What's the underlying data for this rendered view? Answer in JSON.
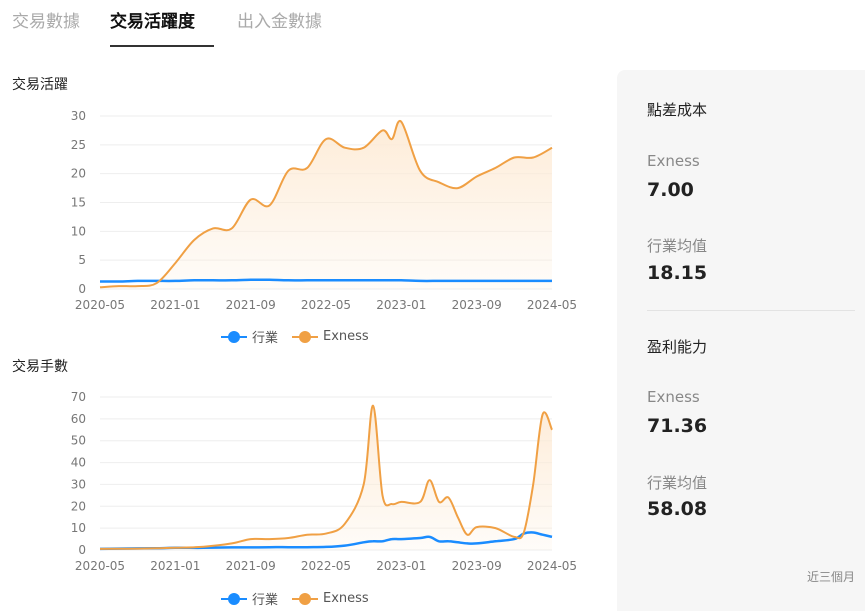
{
  "tabs": [
    {
      "label": "交易數據"
    },
    {
      "label": "交易活躍度"
    },
    {
      "label": "出入金數據"
    }
  ],
  "colors": {
    "industry": "#1a8cff",
    "exness": "#f0a044",
    "exness_fill": "#fdebd6"
  },
  "legend": {
    "industry": "行業",
    "exness": "Exness"
  },
  "charts": {
    "activity_title": "交易活躍",
    "volume_title": "交易手數"
  },
  "side": {
    "spread_title": "點差成本",
    "spread_exness_label": "Exness",
    "spread_exness_value": "7.00",
    "spread_industry_label": "行業均值",
    "spread_industry_value": "18.15",
    "profit_title": "盈利能力",
    "profit_exness_label": "Exness",
    "profit_exness_value": "71.36",
    "profit_industry_label": "行業均值",
    "profit_industry_value": "58.08",
    "footnote": "近三個月"
  },
  "chart_data": [
    {
      "type": "area",
      "title": "交易活躍",
      "x_ticks": [
        "2020-05",
        "2021-01",
        "2021-09",
        "2022-05",
        "2023-01",
        "2023-09",
        "2024-05"
      ],
      "ylim": [
        0,
        30
      ],
      "y_ticks": [
        0,
        5,
        10,
        15,
        20,
        25,
        30
      ],
      "x": [
        "2020-05",
        "2020-07",
        "2020-09",
        "2020-11",
        "2021-01",
        "2021-03",
        "2021-05",
        "2021-07",
        "2021-09",
        "2021-11",
        "2022-01",
        "2022-03",
        "2022-05",
        "2022-07",
        "2022-09",
        "2022-11",
        "2022-12",
        "2023-01",
        "2023-03",
        "2023-05",
        "2023-07",
        "2023-09",
        "2023-11",
        "2024-01",
        "2024-03",
        "2024-05"
      ],
      "series": [
        {
          "name": "行業",
          "values": [
            1.3,
            1.3,
            1.4,
            1.4,
            1.4,
            1.5,
            1.5,
            1.5,
            1.6,
            1.6,
            1.5,
            1.5,
            1.5,
            1.5,
            1.5,
            1.5,
            1.5,
            1.5,
            1.4,
            1.4,
            1.4,
            1.4,
            1.4,
            1.4,
            1.4,
            1.4
          ]
        },
        {
          "name": "Exness",
          "values": [
            0.3,
            0.5,
            0.5,
            1.0,
            4.5,
            8.5,
            10.5,
            10.5,
            15.5,
            14.5,
            20.5,
            21.0,
            26.0,
            24.5,
            24.5,
            27.5,
            26.0,
            29.0,
            20.5,
            18.5,
            17.5,
            19.5,
            21.0,
            22.8,
            22.8,
            24.5
          ]
        }
      ],
      "grid": true,
      "legend_position": "bottom"
    },
    {
      "type": "area",
      "title": "交易手數",
      "x_ticks": [
        "2020-05",
        "2021-01",
        "2021-09",
        "2022-05",
        "2023-01",
        "2023-09",
        "2024-05"
      ],
      "ylim": [
        0,
        70
      ],
      "y_ticks": [
        0,
        10,
        20,
        30,
        40,
        50,
        60,
        70
      ],
      "x": [
        "2020-05",
        "2020-08",
        "2020-11",
        "2021-01",
        "2021-04",
        "2021-07",
        "2021-09",
        "2021-11",
        "2022-01",
        "2022-03",
        "2022-05",
        "2022-07",
        "2022-09",
        "2022-10",
        "2022-11",
        "2022-12",
        "2023-01",
        "2023-03",
        "2023-04",
        "2023-05",
        "2023-06",
        "2023-07",
        "2023-08",
        "2023-09",
        "2023-11",
        "2024-01",
        "2024-02",
        "2024-03",
        "2024-04",
        "2024-05"
      ],
      "series": [
        {
          "name": "行業",
          "values": [
            0.5,
            0.7,
            0.8,
            1.0,
            1.0,
            1.2,
            1.2,
            1.3,
            1.3,
            1.3,
            1.4,
            2.0,
            3.5,
            4.0,
            4.0,
            5.0,
            5.0,
            5.5,
            6.0,
            4.0,
            4.0,
            3.5,
            3.0,
            3.0,
            4.0,
            5.0,
            7.5,
            8.0,
            7.0,
            6.0
          ]
        },
        {
          "name": "Exness",
          "values": [
            0.5,
            0.6,
            0.8,
            1.0,
            1.5,
            3.0,
            5.0,
            5.0,
            5.5,
            7.0,
            7.5,
            12.0,
            30.0,
            66.0,
            25.0,
            21.0,
            22.0,
            22.0,
            32.0,
            22.0,
            24.0,
            15.0,
            7.0,
            10.5,
            10.0,
            6.0,
            8.0,
            30.0,
            62.0,
            55.0
          ]
        }
      ],
      "grid": true,
      "legend_position": "bottom"
    }
  ]
}
